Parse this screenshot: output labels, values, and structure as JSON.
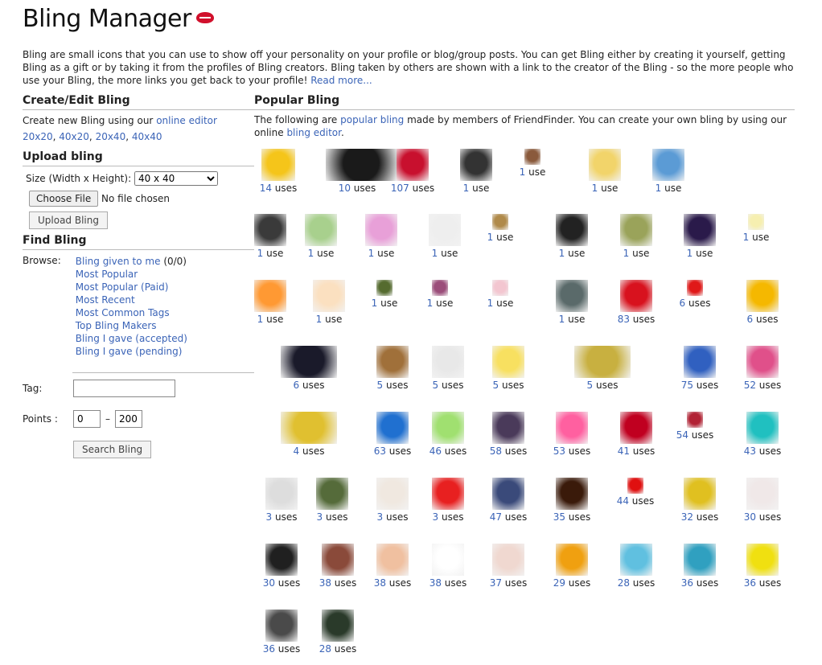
{
  "title": "Bling Manager",
  "intro": {
    "text": "Bling are small icons that you can use to show off your personality on your profile or blog/group posts. You can get Bling either by creating it yourself, getting Bling as a gift or by taking it from the profiles of Bling creators. Bling taken by others are shown with a link to the creator of the Bling - so the more people who use your Bling, the more links you get back to your profile!",
    "read_more": "Read more..."
  },
  "create": {
    "heading": "Create/Edit Bling",
    "text": "Create new Bling using our",
    "link": "online editor",
    "sizes": [
      "20x20",
      "40x20",
      "20x40",
      "40x40"
    ]
  },
  "upload": {
    "heading": "Upload bling",
    "size_label": "Size (Width x Height):",
    "size_value": "40 x 40",
    "choose_file": "Choose File",
    "no_file": "No file chosen",
    "upload_button": "Upload Bling"
  },
  "find": {
    "heading": "Find Bling",
    "browse_label": "Browse:",
    "browse_items": [
      "Bling given to me",
      "Most Popular",
      "Most Popular (Paid)",
      "Most Recent",
      "Most Common Tags",
      "Top Bling Makers",
      "Bling I gave (accepted)",
      "Bling I gave (pending)"
    ],
    "given_count": "(0/0)",
    "tag_label": "Tag:",
    "points_label": "Points :",
    "points_min": "0",
    "points_dash": "–",
    "points_max": "200",
    "search_button": "Search Bling"
  },
  "popular": {
    "heading": "Popular Bling",
    "text_before": "The following are",
    "link1": "popular bling",
    "text_after": "made by members of FriendFinder. You can create your own bling by using our online",
    "link2": "bling editor",
    "uses_word": "use",
    "uses_word_plural": "uses",
    "items": [
      {
        "n": "14",
        "color": "#f5c51a",
        "icon": "smiley-wave-icon"
      },
      {
        "n": "10",
        "color": "#1a1a1a",
        "icon": "fireworks-icon"
      },
      {
        "n": "107",
        "color": "#c8102e",
        "icon": "rose-icon"
      },
      {
        "n": "1",
        "color": "#333333",
        "icon": "hand-icon"
      },
      {
        "n": "1",
        "color": "#8a5a3c",
        "icon": "portrait-icon"
      },
      {
        "n": "1",
        "color": "#f2d46a",
        "icon": "real-icon"
      },
      {
        "n": "1",
        "color": "#5b9bd5",
        "icon": "blue-card-icon"
      },
      {
        "n": "1",
        "color": "#3a3a3a",
        "icon": "woman-icon"
      },
      {
        "n": "1",
        "color": "#a8d08d",
        "icon": "thank-you-icon"
      },
      {
        "n": "1",
        "color": "#e8a0d8",
        "icon": "glitter-icon"
      },
      {
        "n": "1",
        "color": "#eeeeee",
        "icon": "envelope-icon"
      },
      {
        "n": "1",
        "color": "#b08a4a",
        "icon": "figure-icon"
      },
      {
        "n": "1",
        "color": "#222222",
        "icon": "dark-card-icon"
      },
      {
        "n": "1",
        "color": "#9aa35a",
        "icon": "face-paint-icon"
      },
      {
        "n": "1",
        "color": "#2a1a4a",
        "icon": "sparkle-icon"
      },
      {
        "n": "1",
        "color": "#f6efb0",
        "icon": "note-icon"
      },
      {
        "n": "1",
        "color": "#ff9933",
        "icon": "rainbow-icon"
      },
      {
        "n": "1",
        "color": "#fbe0c0",
        "icon": "sorry-icon"
      },
      {
        "n": "1",
        "color": "#556b2f",
        "icon": "sunflower-small-icon"
      },
      {
        "n": "1",
        "color": "#9b4d7a",
        "icon": "collage-icon"
      },
      {
        "n": "1",
        "color": "#f3c6d0",
        "icon": "card-icon"
      },
      {
        "n": "1",
        "color": "#5a6a6a",
        "icon": "photo-icon"
      },
      {
        "n": "83",
        "color": "#d8121e",
        "icon": "lips-icon"
      },
      {
        "n": "6",
        "color": "#e01818",
        "icon": "heart-icon"
      },
      {
        "n": "6",
        "color": "#f5b800",
        "icon": "kiss-smiley-icon"
      },
      {
        "n": "6",
        "color": "#1a1a2a",
        "icon": "neon-hearts-icon"
      },
      {
        "n": "5",
        "color": "#a0703a",
        "icon": "baby-icon"
      },
      {
        "n": "5",
        "color": "#e8e8e8",
        "icon": "bunnies-icon"
      },
      {
        "n": "5",
        "color": "#f8e060",
        "icon": "chick-icon"
      },
      {
        "n": "5",
        "color": "#c8b040",
        "icon": "minion-icon"
      },
      {
        "n": "75",
        "color": "#3060c0",
        "icon": "music-heart-icon"
      },
      {
        "n": "52",
        "color": "#e0508a",
        "icon": "lotus-icon"
      },
      {
        "n": "4",
        "color": "#e0c030",
        "icon": "minion-face-icon"
      },
      {
        "n": "63",
        "color": "#2070d0",
        "icon": "dove-icon"
      },
      {
        "n": "46",
        "color": "#a0e070",
        "icon": "just-love-me-icon"
      },
      {
        "n": "58",
        "color": "#4a3a5a",
        "icon": "pose-icon"
      },
      {
        "n": "53",
        "color": "#ff60a0",
        "icon": "rainbow-rose-icon"
      },
      {
        "n": "41",
        "color": "#c00020",
        "icon": "best-wishes-icon"
      },
      {
        "n": "54",
        "color": "#b22234",
        "icon": "flag-icon"
      },
      {
        "n": "43",
        "color": "#20c0c0",
        "icon": "smile-heart-icon"
      },
      {
        "n": "3",
        "color": "#dddddd",
        "icon": "panda-icon"
      },
      {
        "n": "3",
        "color": "#556b3a",
        "icon": "zebra-icon"
      },
      {
        "n": "3",
        "color": "#f0e8e0",
        "icon": "bunny-icon"
      },
      {
        "n": "3",
        "color": "#e82020",
        "icon": "snoopy-icon"
      },
      {
        "n": "47",
        "color": "#3a4a7a",
        "icon": "pegasus-icon"
      },
      {
        "n": "35",
        "color": "#3a1a0a",
        "icon": "candle-icon"
      },
      {
        "n": "44",
        "color": "#e01010",
        "icon": "red-heart-icon"
      },
      {
        "n": "32",
        "color": "#e0c020",
        "icon": "butterfly-icon"
      },
      {
        "n": "30",
        "color": "#f0e8e8",
        "icon": "red-rose-icon"
      },
      {
        "n": "30",
        "color": "#202020",
        "icon": "nice-day-icon"
      },
      {
        "n": "38",
        "color": "#8a4a3a",
        "icon": "boots-icon"
      },
      {
        "n": "38",
        "color": "#f0c0a0",
        "icon": "heart-hands-icon"
      },
      {
        "n": "38",
        "color": "#ffffff",
        "icon": "angel-icon"
      },
      {
        "n": "37",
        "color": "#f0d8d0",
        "icon": "dancer-icon"
      },
      {
        "n": "29",
        "color": "#f0a010",
        "icon": "sunflower-icon"
      },
      {
        "n": "28",
        "color": "#60c0e0",
        "icon": "beach-icon"
      },
      {
        "n": "36",
        "color": "#30a0c0",
        "icon": "born-free-icon"
      },
      {
        "n": "36",
        "color": "#f0e010",
        "icon": "call-me-icon"
      },
      {
        "n": "36",
        "color": "#4a4a4a",
        "icon": "eagle-icon"
      },
      {
        "n": "28",
        "color": "#2a3a2a",
        "icon": "flower-card-icon"
      }
    ]
  }
}
